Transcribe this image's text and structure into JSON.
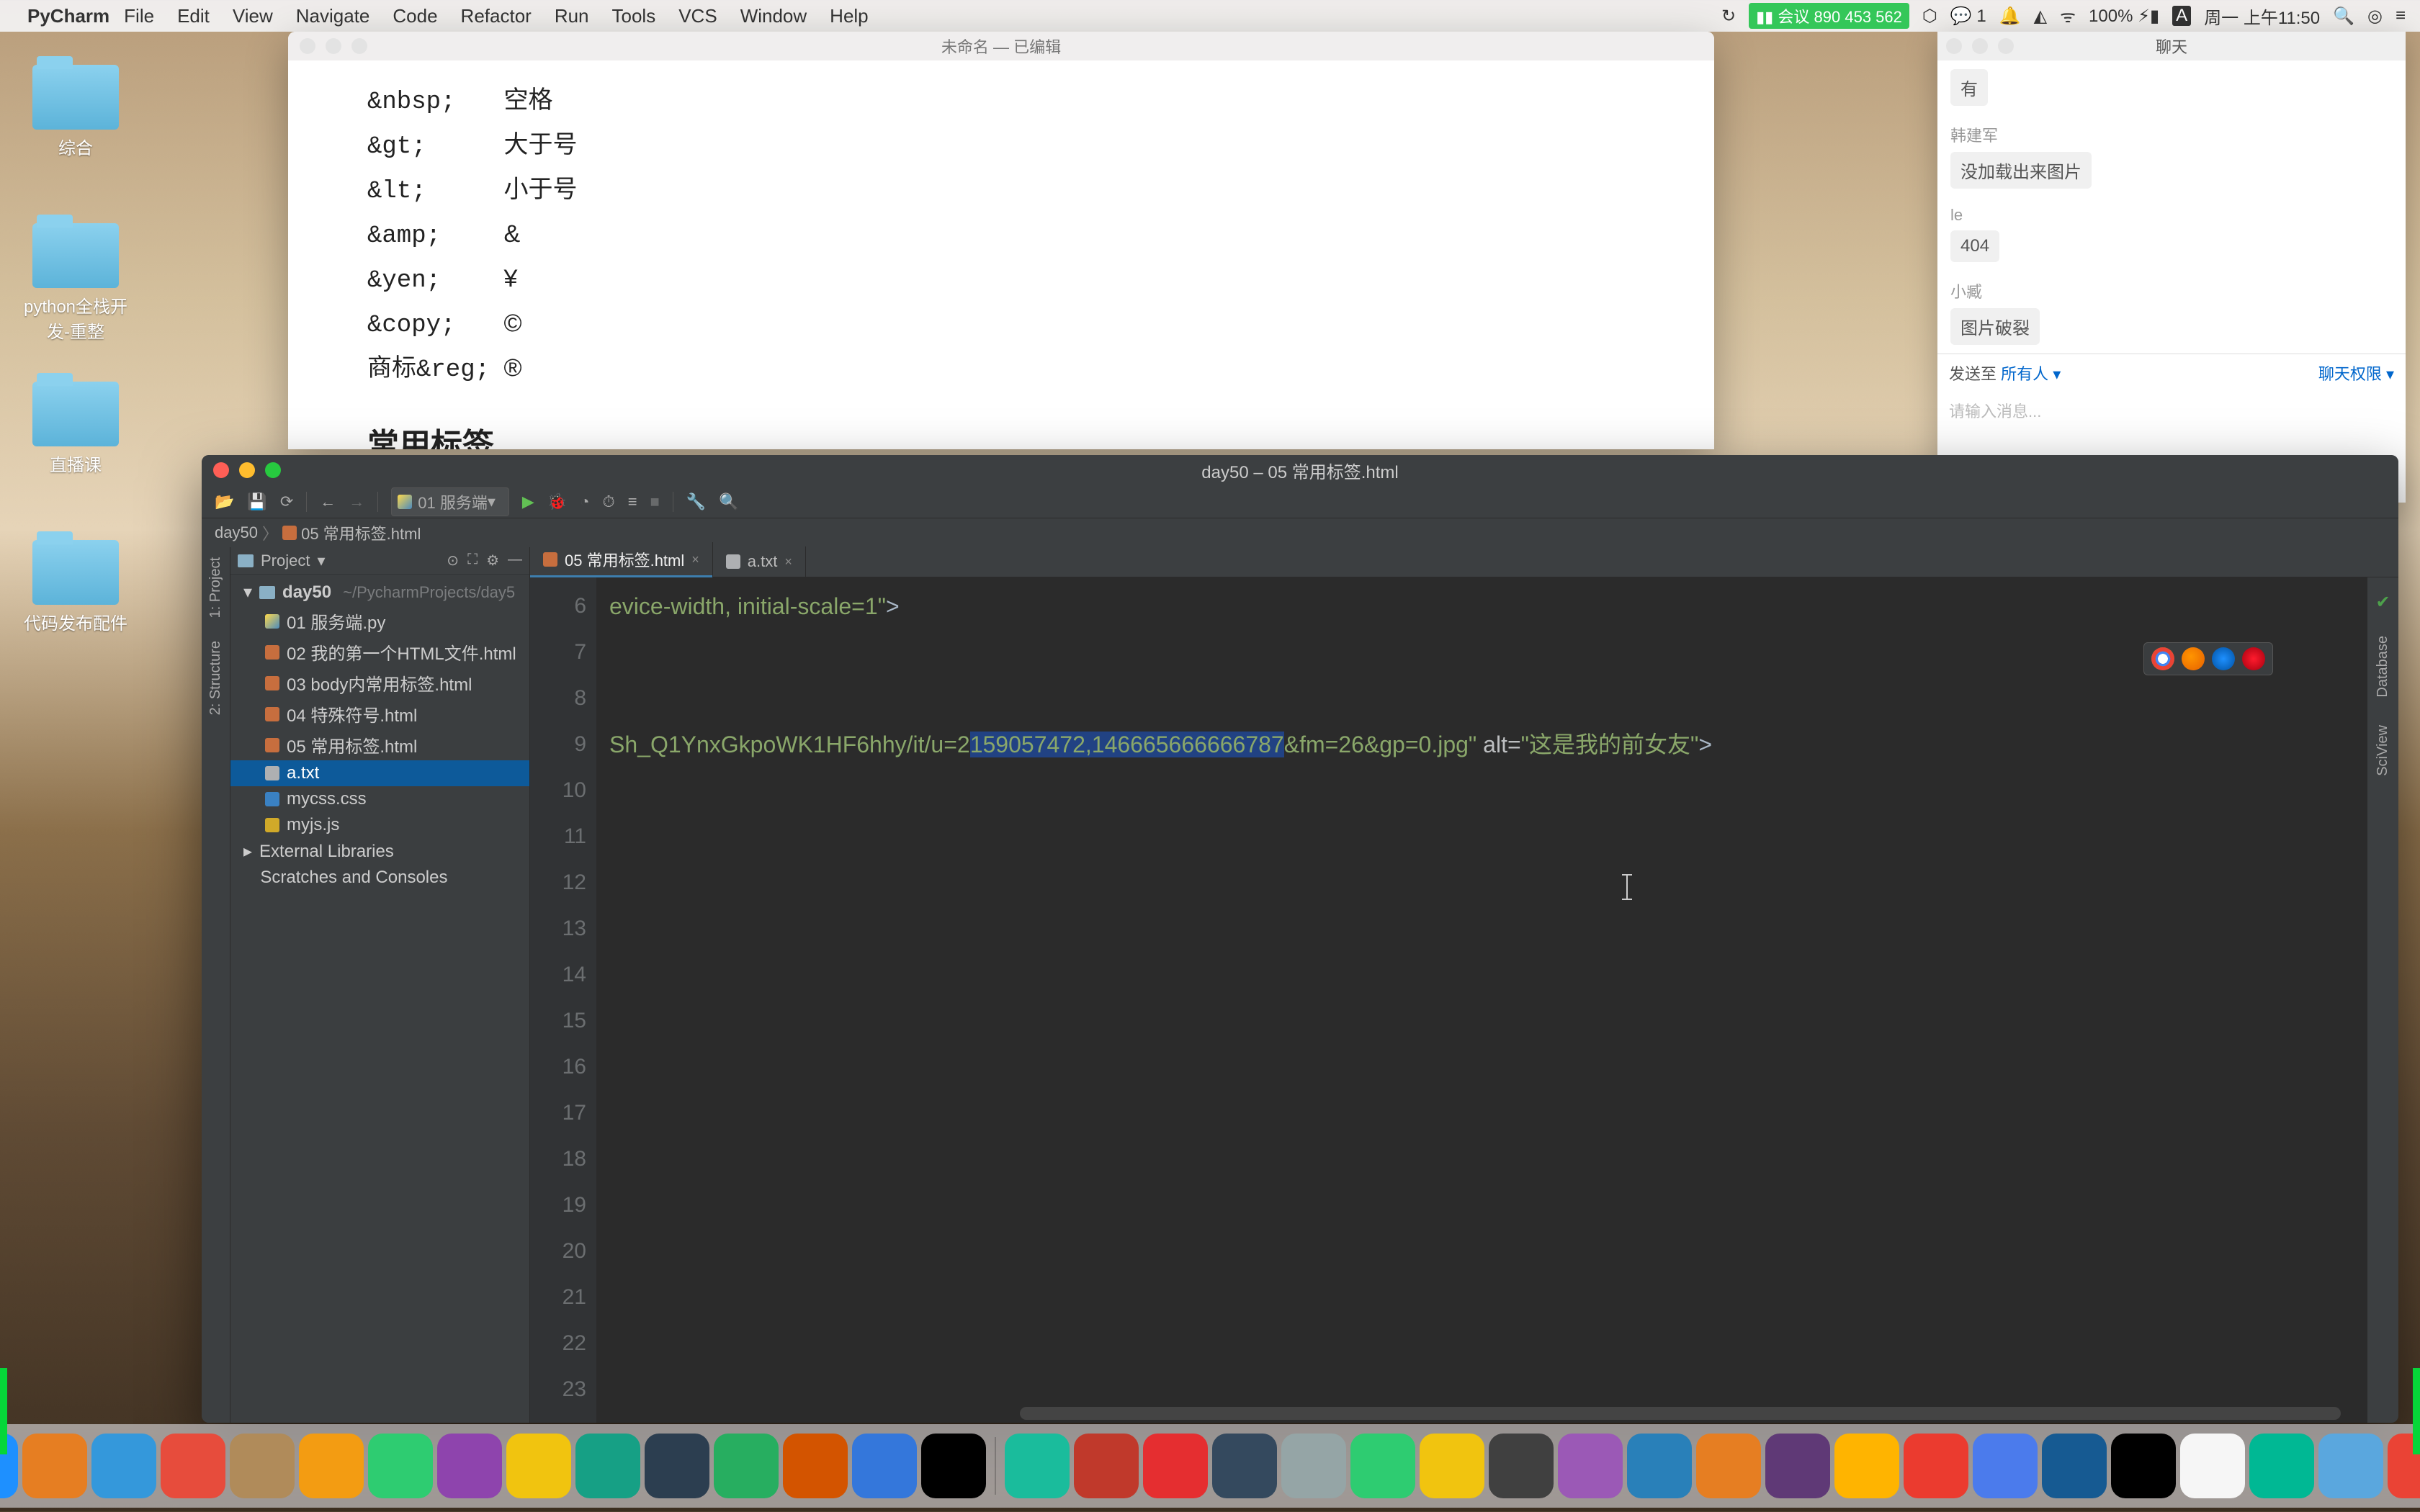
{
  "menubar": {
    "app": "PyCharm",
    "items": [
      "File",
      "Edit",
      "View",
      "Navigate",
      "Code",
      "Refactor",
      "Run",
      "Tools",
      "VCS",
      "Window",
      "Help"
    ],
    "meeting": "会议 890 453 562",
    "wechat_badge": "1",
    "battery": "100%",
    "clock": "周一 上午11:50"
  },
  "desktop": {
    "icons": [
      "综合",
      "python全栈开发-重整",
      "直播课",
      "代码发布配件"
    ]
  },
  "preview": {
    "title": "未命名 — 已编辑",
    "rows": [
      {
        "entity": "&nbsp;",
        "label": "空格"
      },
      {
        "entity": "&gt;",
        "label": "大于号"
      },
      {
        "entity": "&lt;",
        "label": "小于号"
      },
      {
        "entity": "&amp;",
        "label": "&"
      },
      {
        "entity": "&yen;",
        "label": "¥"
      },
      {
        "entity": "&copy;",
        "label": "©"
      },
      {
        "entity": "商标&reg;",
        "label": "®"
      }
    ],
    "heading": "常用标签"
  },
  "chat": {
    "title": "聊天",
    "messages": [
      {
        "author": "",
        "text": "有"
      },
      {
        "author": "韩建军",
        "text": "没加载出来图片"
      },
      {
        "author": "le",
        "text": "404"
      },
      {
        "author": "小臧",
        "text": "图片破裂"
      }
    ],
    "send_to_label": "发送至",
    "send_to_value": "所有人",
    "perm_link": "聊天权限",
    "input_placeholder": "请输入消息..."
  },
  "pycharm": {
    "window_title": "day50 – 05 常用标签.html",
    "toolbar": {
      "config": "01 服务端"
    },
    "crumbs": [
      "day50",
      "05 常用标签.html"
    ],
    "left_tabs": [
      "1: Project",
      "2: Structure"
    ],
    "right_tabs": [
      "Database",
      "SciView"
    ],
    "project": {
      "title": "Project",
      "root": "day50",
      "root_path": "~/PycharmProjects/day5",
      "files": [
        {
          "name": "01 服务端.py",
          "icon": "py"
        },
        {
          "name": "02 我的第一个HTML文件.html",
          "icon": "html"
        },
        {
          "name": "03 body内常用标签.html",
          "icon": "html"
        },
        {
          "name": "04 特殊符号.html",
          "icon": "html"
        },
        {
          "name": "05 常用标签.html",
          "icon": "html"
        },
        {
          "name": "a.txt",
          "icon": "txt",
          "sel": true
        },
        {
          "name": "mycss.css",
          "icon": "css"
        },
        {
          "name": "myjs.js",
          "icon": "js"
        }
      ],
      "extra": [
        "External Libraries",
        "Scratches and Consoles"
      ]
    },
    "tabs": [
      {
        "name": "05 常用标签.html",
        "icon": "html",
        "active": true
      },
      {
        "name": "a.txt",
        "icon": "txt",
        "active": false
      }
    ],
    "gutter_start": 6,
    "gutter_end": 23,
    "code": {
      "line6_suffix_str": "evice-width, initial-scale=1\"",
      "line6_gt": ">",
      "line9_prefix_str": "Sh_Q1YnxGkpoWK1HF6hhy/it/u=2",
      "line9_sel": "159057472,146665666666787",
      "line9_after_sel": "&fm=26&gp=0.jpg\"",
      "line9_attr_alt": " alt=",
      "line9_alt_val": "\"这是我的前女友\"",
      "line9_gt": ">"
    }
  },
  "dock": {
    "groups": [
      [
        "finder",
        "siri",
        "launchpad",
        "safari",
        "preview",
        "mail",
        "calendar",
        "contacts",
        "reminders",
        "messages",
        "podcast",
        "notes",
        "wechat-work",
        "map",
        "numbers",
        "keynote",
        "vscode",
        "iterm"
      ],
      [
        "activity",
        "music",
        "youku",
        "video",
        "settings",
        "tencent",
        "wechat",
        "qq",
        "xmind",
        "dingtalk",
        "thunder",
        "wps",
        "vs",
        "postgres",
        "terminal",
        "paper",
        "zoom",
        "snip",
        "chrome",
        "drawio",
        "pycharm",
        "diagram"
      ],
      [
        "folder",
        "trash"
      ]
    ]
  }
}
